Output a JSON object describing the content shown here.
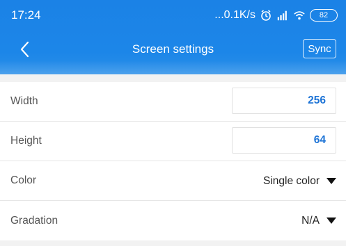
{
  "status_bar": {
    "time": "17:24",
    "net_speed": "...0.1K/s",
    "battery": "82"
  },
  "nav": {
    "title": "Screen settings",
    "sync_label": "Sync"
  },
  "settings": {
    "width": {
      "label": "Width",
      "value": "256"
    },
    "height": {
      "label": "Height",
      "value": "64"
    },
    "color": {
      "label": "Color",
      "value": "Single color"
    },
    "gradation": {
      "label": "Gradation",
      "value": "N/A"
    }
  },
  "colors": {
    "header": "#1c86e8",
    "value_blue": "#1e74d6",
    "background": "#f2f2f2"
  }
}
